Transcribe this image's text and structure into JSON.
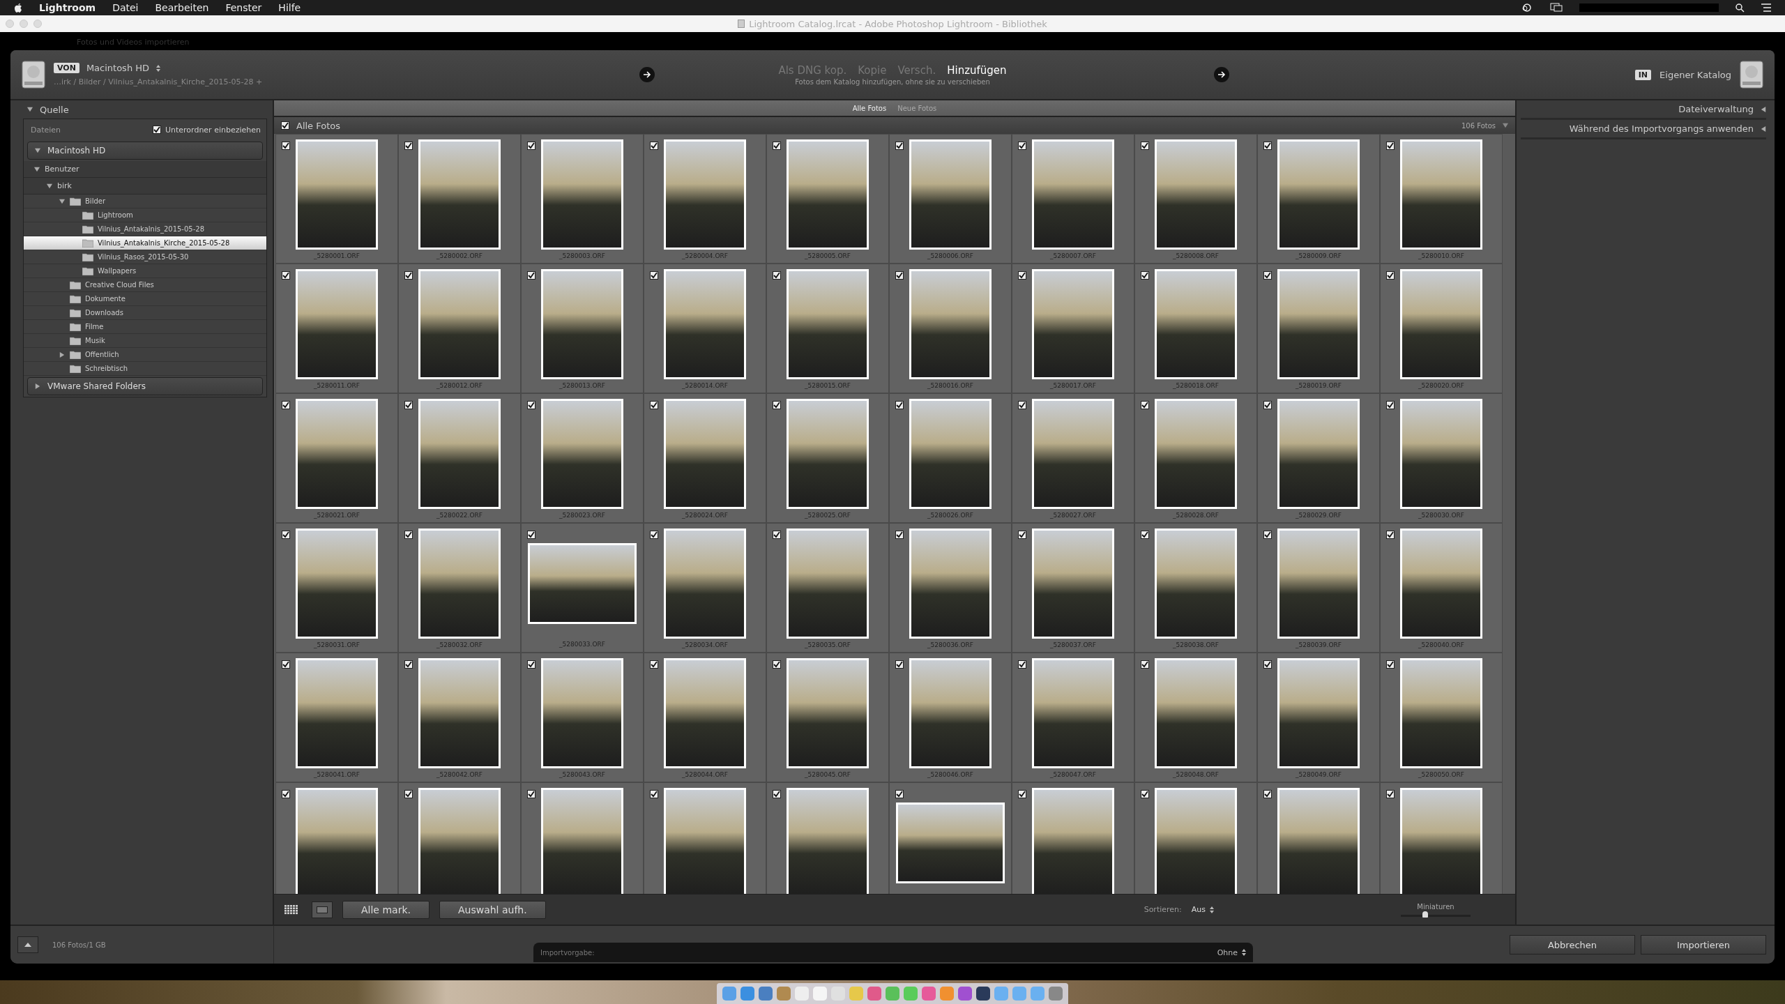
{
  "menu_bar": {
    "app": "Lightroom",
    "items": [
      "Datei",
      "Bearbeiten",
      "Fenster",
      "Hilfe"
    ]
  },
  "window": {
    "title": "Lightroom Catalog.lrcat - Adobe Photoshop Lightroom - Bibliothek",
    "background_title": "Fotos und Videos importieren"
  },
  "source": {
    "badge": "VON",
    "volume": "Macintosh HD",
    "path": "…irk / Bilder / Vilnius_Antakalnis_Kirche_2015-05-28 +"
  },
  "modes": [
    {
      "label": "Als DNG kop.",
      "selected": false
    },
    {
      "label": "Kopie",
      "selected": false
    },
    {
      "label": "Versch.",
      "selected": false
    },
    {
      "label": "Hinzufügen",
      "selected": true
    }
  ],
  "mode_hint": "Fotos dem Katalog hinzufügen, ohne sie zu verschieben",
  "destination": {
    "badge": "IN",
    "label": "Eigener Katalog"
  },
  "source_panel": {
    "title": "Quelle",
    "files_label": "Dateien",
    "include_subfolders": {
      "label": "Unterordner einbeziehen",
      "checked": true
    },
    "volumes": [
      {
        "name": "Macintosh HD",
        "expanded": true,
        "children": [
          {
            "name": "Benutzer",
            "kind": "group",
            "expanded": true,
            "selected": false,
            "children": [
              {
                "name": "birk",
                "kind": "group",
                "expanded": true,
                "selected": false,
                "children": [
                  {
                    "name": "Bilder",
                    "kind": "folder",
                    "expanded": true,
                    "selected": false,
                    "children": [
                      {
                        "name": "Lightroom",
                        "kind": "folder",
                        "selected": false
                      },
                      {
                        "name": "Vilnius_Antakalnis_2015-05-28",
                        "kind": "folder",
                        "selected": false
                      },
                      {
                        "name": "Vilnius_Antakalnis_Kirche_2015-05-28",
                        "kind": "folder",
                        "selected": true
                      },
                      {
                        "name": "Vilnius_Rasos_2015-05-30",
                        "kind": "folder",
                        "selected": false
                      },
                      {
                        "name": "Wallpapers",
                        "kind": "folder",
                        "selected": false
                      }
                    ]
                  },
                  {
                    "name": "Creative Cloud Files",
                    "kind": "folder",
                    "selected": false
                  },
                  {
                    "name": "Dokumente",
                    "kind": "folder",
                    "selected": false
                  },
                  {
                    "name": "Downloads",
                    "kind": "folder",
                    "selected": false
                  },
                  {
                    "name": "Filme",
                    "kind": "folder",
                    "selected": false
                  },
                  {
                    "name": "Musik",
                    "kind": "folder",
                    "selected": false
                  },
                  {
                    "name": "Offentlich",
                    "kind": "folder",
                    "expanded": false,
                    "selected": false
                  },
                  {
                    "name": "Schreibtisch",
                    "kind": "folder",
                    "selected": false
                  }
                ]
              }
            ]
          }
        ]
      },
      {
        "name": "VMware Shared Folders",
        "expanded": false
      }
    ]
  },
  "grid_tabs": [
    {
      "label": "Alle Fotos",
      "selected": true
    },
    {
      "label": "Neue Fotos",
      "selected": false
    }
  ],
  "grid_header": {
    "label": "Alle Fotos",
    "checked": true,
    "count": "106 Fotos"
  },
  "photos": [
    {
      "name": "_5280001.ORF",
      "kind": "portrait",
      "checked": true
    },
    {
      "name": "_5280002.ORF",
      "kind": "portrait",
      "checked": true
    },
    {
      "name": "_5280003.ORF",
      "kind": "portrait",
      "checked": true
    },
    {
      "name": "_5280004.ORF",
      "kind": "portrait",
      "checked": true
    },
    {
      "name": "_5280005.ORF",
      "kind": "portrait",
      "checked": true
    },
    {
      "name": "_5280006.ORF",
      "kind": "portrait",
      "checked": true
    },
    {
      "name": "_5280007.ORF",
      "kind": "portrait",
      "checked": true
    },
    {
      "name": "_5280008.ORF",
      "kind": "portrait",
      "checked": true
    },
    {
      "name": "_5280009.ORF",
      "kind": "portrait",
      "checked": true
    },
    {
      "name": "_5280010.ORF",
      "kind": "portrait",
      "checked": true
    },
    {
      "name": "_5280011.ORF",
      "kind": "portrait",
      "checked": true
    },
    {
      "name": "_5280012.ORF",
      "kind": "portrait",
      "checked": true
    },
    {
      "name": "_5280013.ORF",
      "kind": "portrait",
      "checked": true
    },
    {
      "name": "_5280014.ORF",
      "kind": "portrait",
      "checked": true
    },
    {
      "name": "_5280015.ORF",
      "kind": "portrait",
      "checked": true
    },
    {
      "name": "_5280016.ORF",
      "kind": "portrait",
      "checked": true
    },
    {
      "name": "_5280017.ORF",
      "kind": "portrait",
      "checked": true
    },
    {
      "name": "_5280018.ORF",
      "kind": "portrait",
      "checked": true
    },
    {
      "name": "_5280019.ORF",
      "kind": "portrait",
      "checked": true
    },
    {
      "name": "_5280020.ORF",
      "kind": "portrait",
      "checked": true
    },
    {
      "name": "_5280021.ORF",
      "kind": "portrait",
      "checked": true
    },
    {
      "name": "_5280022.ORF",
      "kind": "portrait",
      "checked": true
    },
    {
      "name": "_5280023.ORF",
      "kind": "portrait",
      "checked": true
    },
    {
      "name": "_5280024.ORF",
      "kind": "portrait",
      "checked": true
    },
    {
      "name": "_5280025.ORF",
      "kind": "portrait",
      "checked": true
    },
    {
      "name": "_5280026.ORF",
      "kind": "portrait",
      "checked": true
    },
    {
      "name": "_5280027.ORF",
      "kind": "portrait",
      "checked": true
    },
    {
      "name": "_5280028.ORF",
      "kind": "portrait",
      "checked": true
    },
    {
      "name": "_5280029.ORF",
      "kind": "portrait",
      "checked": true
    },
    {
      "name": "_5280030.ORF",
      "kind": "portrait",
      "checked": true
    },
    {
      "name": "_5280031.ORF",
      "kind": "portrait",
      "checked": true
    },
    {
      "name": "_5280032.ORF",
      "kind": "portrait",
      "checked": true
    },
    {
      "name": "_5280033.ORF",
      "kind": "landscape",
      "checked": true
    },
    {
      "name": "_5280034.ORF",
      "kind": "portrait",
      "checked": true
    },
    {
      "name": "_5280035.ORF",
      "kind": "portrait",
      "checked": true
    },
    {
      "name": "_5280036.ORF",
      "kind": "portrait",
      "checked": true
    },
    {
      "name": "_5280037.ORF",
      "kind": "portrait",
      "checked": true
    },
    {
      "name": "_5280038.ORF",
      "kind": "portrait",
      "checked": true
    },
    {
      "name": "_5280039.ORF",
      "kind": "portrait",
      "checked": true
    },
    {
      "name": "_5280040.ORF",
      "kind": "portrait",
      "checked": true
    },
    {
      "name": "_5280041.ORF",
      "kind": "portrait",
      "checked": true
    },
    {
      "name": "_5280042.ORF",
      "kind": "portrait",
      "checked": true
    },
    {
      "name": "_5280043.ORF",
      "kind": "portrait",
      "checked": true
    },
    {
      "name": "_5280044.ORF",
      "kind": "portrait",
      "checked": true
    },
    {
      "name": "_5280045.ORF",
      "kind": "portrait",
      "checked": true
    },
    {
      "name": "_5280046.ORF",
      "kind": "portrait",
      "checked": true
    },
    {
      "name": "_5280047.ORF",
      "kind": "portrait",
      "checked": true
    },
    {
      "name": "_5280048.ORF",
      "kind": "portrait",
      "checked": true
    },
    {
      "name": "_5280049.ORF",
      "kind": "portrait",
      "checked": true
    },
    {
      "name": "_5280050.ORF",
      "kind": "portrait",
      "checked": true
    },
    {
      "kind": "portrait",
      "checked": true
    },
    {
      "kind": "portrait",
      "checked": true
    },
    {
      "kind": "portrait",
      "checked": true
    },
    {
      "kind": "portrait",
      "checked": true
    },
    {
      "kind": "portrait",
      "checked": true
    },
    {
      "kind": "landscape",
      "checked": true
    },
    {
      "kind": "portrait",
      "checked": true
    },
    {
      "kind": "portrait",
      "checked": true
    },
    {
      "kind": "portrait",
      "checked": true
    },
    {
      "kind": "portrait",
      "checked": true
    }
  ],
  "toolbar": {
    "buttons": [
      "Alle mark.",
      "Auswahl aufh."
    ],
    "sort_label": "Sortieren:",
    "sort_value": "Aus",
    "thumbnails": {
      "label": "Miniaturen",
      "level": 0.35
    }
  },
  "right_panel": {
    "sections": [
      "Dateiverwaltung",
      "Während des Importvorgangs anwenden"
    ]
  },
  "footer": {
    "summary": "106 Fotos/1 GB",
    "preset_label": "Importvorgabe:",
    "preset_value": "Ohne",
    "buttons": [
      "Abbrechen",
      "Importieren"
    ]
  }
}
